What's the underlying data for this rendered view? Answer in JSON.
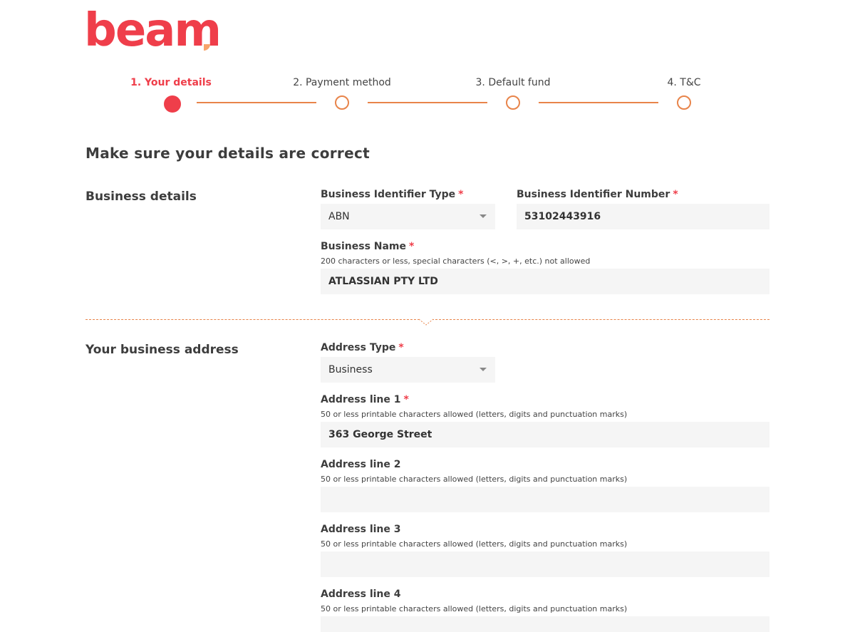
{
  "brand": {
    "name": "beam",
    "primary_color": "#ef3e4a",
    "accent_color": "#e8844a",
    "logo_dot_color": "#f7a46a"
  },
  "stepper": {
    "steps": [
      {
        "label": "1. Your details",
        "state": "active"
      },
      {
        "label": "2. Payment method",
        "state": "upcoming"
      },
      {
        "label": "3. Default fund",
        "state": "upcoming"
      },
      {
        "label": "4. T&C",
        "state": "upcoming"
      }
    ]
  },
  "page": {
    "title": "Make sure your details are correct"
  },
  "business_details": {
    "section_title": "Business details",
    "identifier_type": {
      "label": "Business Identifier Type",
      "required": "*",
      "value": "ABN"
    },
    "identifier_number": {
      "label": "Business Identifier Number",
      "required": "*",
      "value": "53102443916"
    },
    "business_name": {
      "label": "Business Name",
      "required": "*",
      "hint": "200 characters or less, special characters (<, >, +, etc.) not allowed",
      "value": "ATLASSIAN PTY LTD"
    }
  },
  "business_address": {
    "section_title": "Your business address",
    "address_type": {
      "label": "Address Type",
      "required": "*",
      "value": "Business"
    },
    "line1": {
      "label": "Address line 1",
      "required": "*",
      "hint": "50 or less printable characters allowed (letters, digits and punctuation marks)",
      "value": "363 George Street"
    },
    "line2": {
      "label": "Address line 2",
      "hint": "50 or less printable characters allowed (letters, digits and punctuation marks)",
      "value": ""
    },
    "line3": {
      "label": "Address line 3",
      "hint": "50 or less printable characters allowed (letters, digits and punctuation marks)",
      "value": ""
    },
    "line4": {
      "label": "Address line 4",
      "hint": "50 or less printable characters allowed (letters, digits and punctuation marks)",
      "value": ""
    }
  }
}
